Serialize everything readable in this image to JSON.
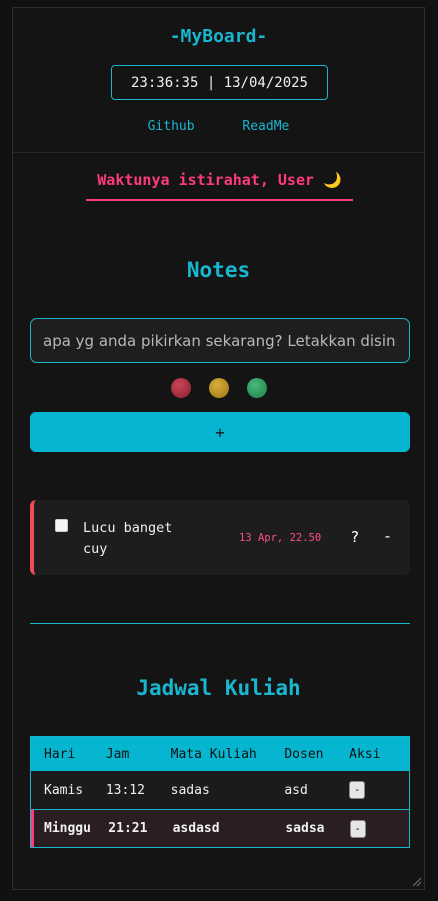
{
  "header": {
    "brand": "-MyBoard-",
    "clock": "23:36:35 | 13/04/2025",
    "links": [
      "Github",
      "ReadMe"
    ]
  },
  "greeting": "Waktunya istirahat, User 🌙",
  "notes": {
    "title": "Notes",
    "placeholder": "apa yg anda pikirkan sekarang? Letakkan disini.",
    "colors": [
      "#b3283e",
      "#c99a1f",
      "#2ea563"
    ],
    "add_label": "+",
    "items": [
      {
        "text": "Lucu banget cuy",
        "date": "13 Apr, 22.50",
        "q_label": "?",
        "del_label": "-",
        "accent": "#ef4b58"
      }
    ]
  },
  "schedule": {
    "title": "Jadwal Kuliah",
    "headers": [
      "Hari",
      "Jam",
      "Mata Kuliah",
      "Dosen",
      "Aksi"
    ],
    "rows": [
      {
        "hari": "Kamis",
        "jam": "13:12",
        "matkul": "sadas",
        "dosen": "asd",
        "aksi": "-"
      },
      {
        "hari": "Minggu",
        "jam": "21:21",
        "matkul": "asdasd",
        "dosen": "sadsa",
        "aksi": "-"
      }
    ]
  }
}
